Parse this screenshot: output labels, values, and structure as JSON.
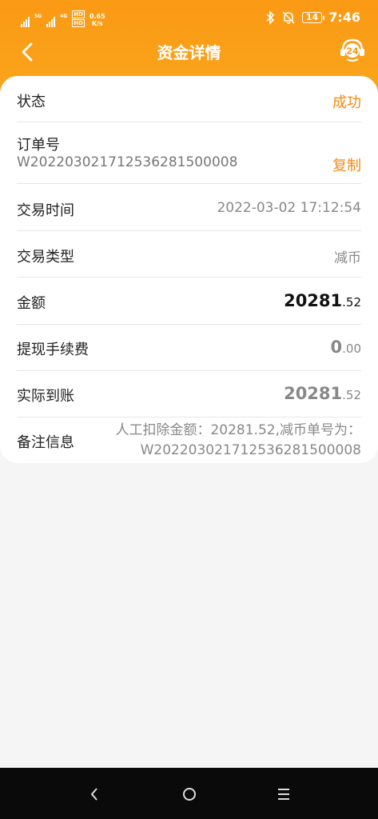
{
  "statusbar": {
    "net1": "5G",
    "net2": "4G",
    "hd1": "HD",
    "hd2": "HD",
    "speed_value": "0.65",
    "speed_unit": "K/s",
    "battery": "14",
    "time": "7:46"
  },
  "header": {
    "title": "资金详情",
    "service_badge": "24"
  },
  "details": {
    "status": {
      "label": "状态",
      "value": "成功"
    },
    "order": {
      "label": "订单号",
      "number": "W202203021712536281500008",
      "copy": "复制"
    },
    "time": {
      "label": "交易时间",
      "value": "2022-03-02 17:12:54"
    },
    "type": {
      "label": "交易类型",
      "value": "减币"
    },
    "amount": {
      "label": "金额",
      "int": "20281",
      "dec": ".52"
    },
    "fee": {
      "label": "提现手续费",
      "int": "0",
      "dec": ".00"
    },
    "received": {
      "label": "实际到账",
      "int": "20281",
      "dec": ".52"
    },
    "remark": {
      "label": "备注信息",
      "value": "人工扣除金额：20281.52,减币单号为：W202203021712536281500008"
    }
  },
  "colors": {
    "accent": "#f5880f",
    "header": "#fb9a14"
  },
  "icons": [
    "back-arrow-icon",
    "customer-service-icon",
    "bluetooth-icon",
    "mute-bell-icon",
    "nav-back-icon",
    "nav-home-icon",
    "nav-menu-icon"
  ]
}
